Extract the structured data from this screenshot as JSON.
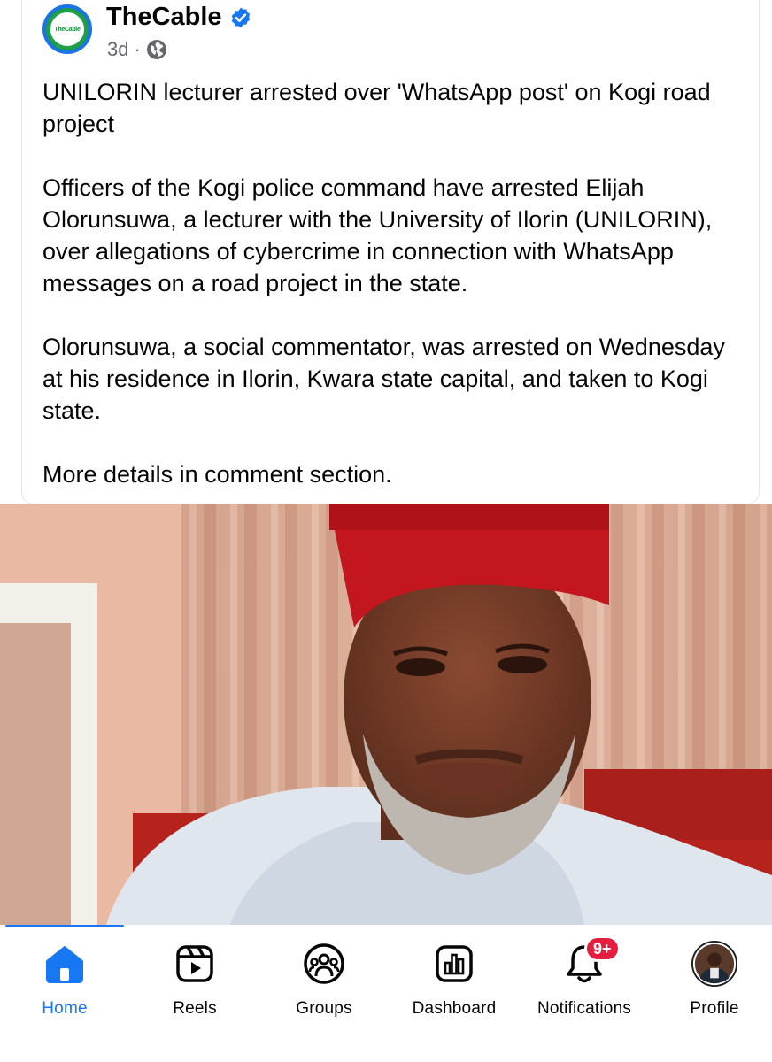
{
  "post": {
    "page_name": "TheCable",
    "avatar_text": "TheCable",
    "time": "3d",
    "separator": "·",
    "paragraphs": [
      "UNILORIN lecturer arrested over 'WhatsApp post' on Kogi road project",
      "Officers of the Kogi police command have arrested Elijah Olorunsuwa, a lecturer with the University of Ilorin (UNILORIN), over allegations of cybercrime in connection with WhatsApp messages on a road project in the state.",
      "Olorunsuwa, a social commentator, was arrested on Wednesday at his residence in Ilorin, Kwara state capital, and taken to Kogi state.",
      "More details in comment section."
    ],
    "icons": {
      "verified": "verified-badge-icon",
      "audience": "globe-icon"
    },
    "photo_subject": "man in red cap and white attire"
  },
  "nav": {
    "items": [
      {
        "label": "Home",
        "icon": "home-icon",
        "active": true
      },
      {
        "label": "Reels",
        "icon": "reels-icon",
        "active": false
      },
      {
        "label": "Groups",
        "icon": "groups-icon",
        "active": false
      },
      {
        "label": "Dashboard",
        "icon": "dashboard-icon",
        "active": false
      },
      {
        "label": "Notifications",
        "icon": "bell-icon",
        "active": false,
        "badge": "9+"
      },
      {
        "label": "Profile",
        "icon": "profile-avatar",
        "active": false
      }
    ]
  },
  "colors": {
    "accent": "#1877f2",
    "badge": "#e41e3f",
    "secondary_text": "#65676b",
    "verified": "#1877f2"
  }
}
